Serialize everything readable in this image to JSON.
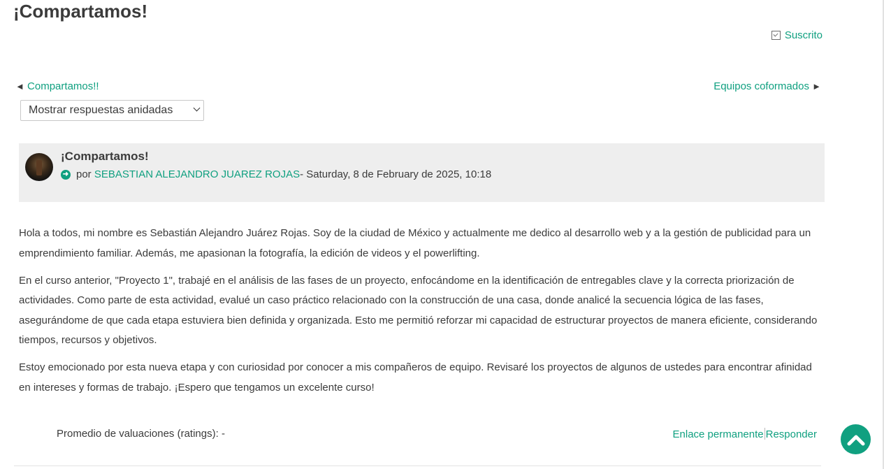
{
  "page": {
    "title": "¡Compartamos!"
  },
  "subscription": {
    "label": "Suscrito"
  },
  "navigation": {
    "prev_label": "Compartamos!!",
    "next_label": "Equipos coformados",
    "prev_arrow": "◄",
    "next_arrow": "►"
  },
  "display_mode": {
    "selected": "Mostrar respuestas anidadas"
  },
  "post": {
    "title": "¡Compartamos!",
    "by_prefix": "por",
    "author": "SEBASTIAN ALEJANDRO JUAREZ ROJAS",
    "date": " - Saturday, 8 de February de 2025, 10:18",
    "paragraphs": [
      "Hola a todos, mi nombre es Sebastián Alejandro Juárez Rojas. Soy de la ciudad de México y actualmente me dedico al desarrollo web y a la gestión de publicidad para un emprendimiento familiar. Además, me apasionan la fotografía, la edición de videos y el powerlifting.",
      "En el curso anterior, \"Proyecto 1\", trabajé en el análisis de las fases de un proyecto, enfocándome en la identificación de entregables clave y la correcta priorización de actividades. Como parte de esta actividad, evalué un caso práctico relacionado con la construcción de una casa, donde analicé la secuencia lógica de las fases, asegurándome de que cada etapa estuviera bien definida y organizada. Esto me permitió reforzar mi capacidad de estructurar proyectos de manera eficiente, considerando tiempos, recursos y objetivos.",
      "Estoy emocionado por esta nueva etapa y con curiosidad por conocer a mis compañeros de equipo. Revisaré los proyectos de algunos de ustedes para encontrar afinidad en intereses y formas de trabajo. ¡Espero que tengamos un excelente curso!"
    ]
  },
  "footer": {
    "rating": "Promedio de valuaciones (ratings): -",
    "permalink": "Enlace permanente",
    "reply": "Responder"
  },
  "colors": {
    "accent": "#10a080",
    "header_bg": "#eeeeee",
    "text": "#3b3b3b"
  },
  "icons": {
    "subscribed": "checkbox-checked-icon",
    "author": "arrow-circle-right-icon",
    "back_to_top": "chevron-up-icon"
  }
}
